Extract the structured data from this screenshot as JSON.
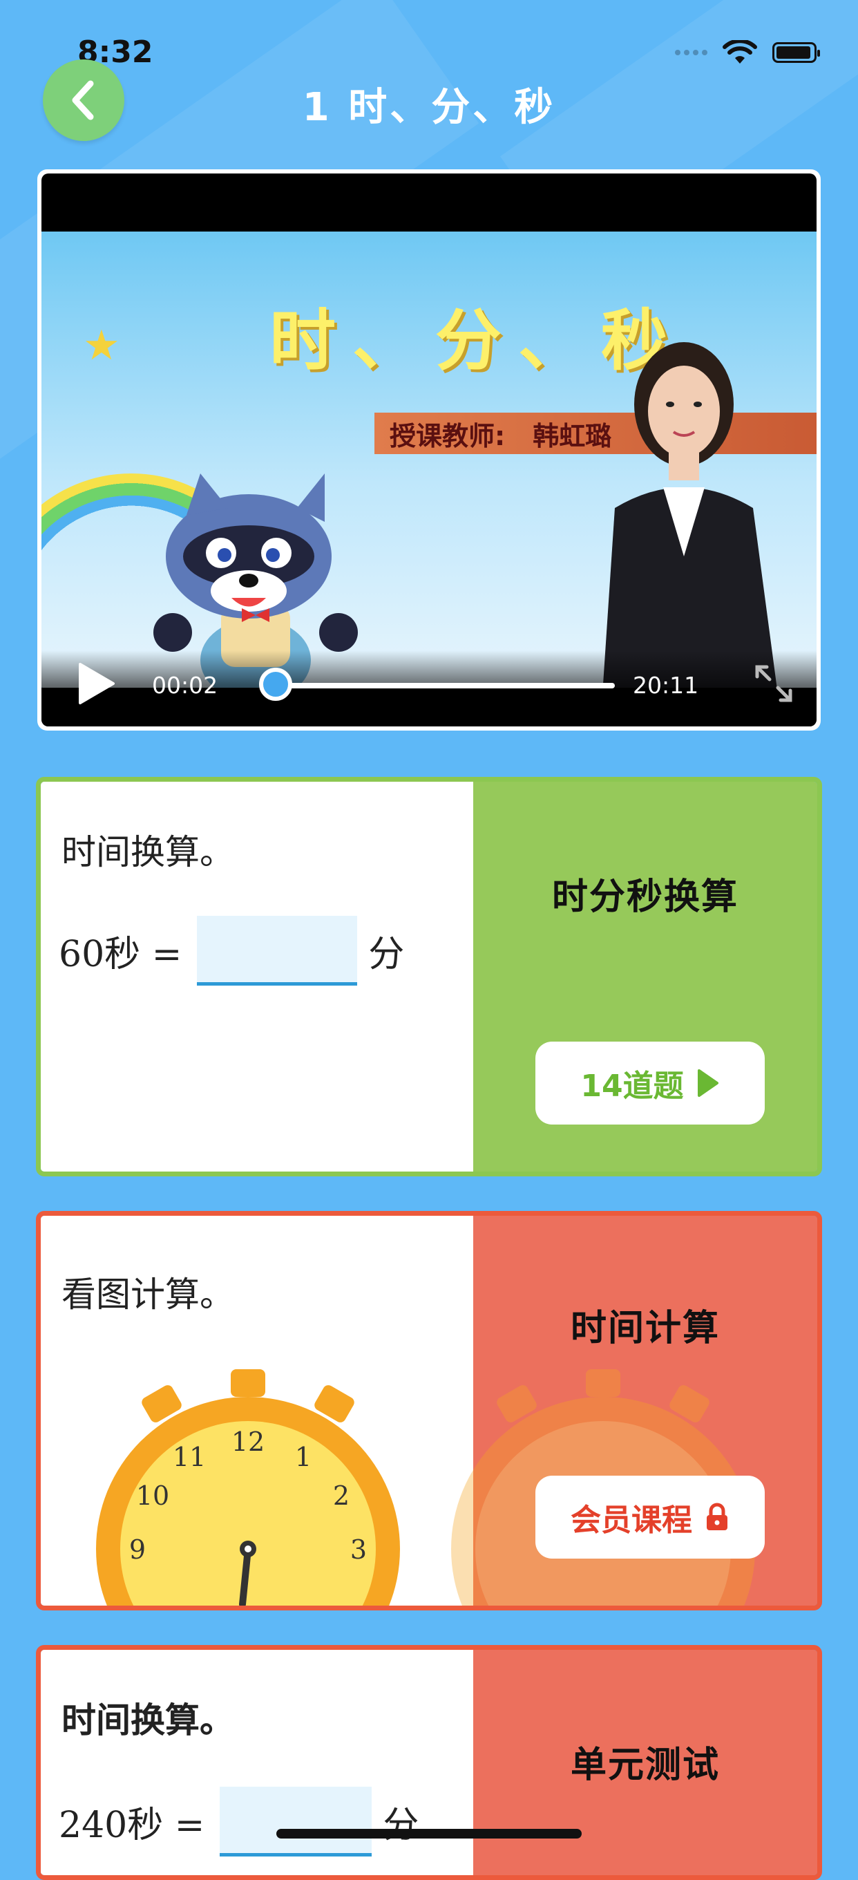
{
  "status": {
    "time": "8:32"
  },
  "header": {
    "title": "1 时、分、秒"
  },
  "video": {
    "slide_title": "时、分、秒",
    "teacher_label": "授课教师:",
    "teacher_name": "韩虹璐",
    "current_time": "00:02",
    "total_time": "20:11",
    "progress": 0.002
  },
  "cards": [
    {
      "question_title": "时间换算。",
      "question_lhs": "60秒 =",
      "question_unit": "分",
      "section_title": "时分秒换算",
      "action_label": "14道题",
      "action_icon": "play-triangle-icon",
      "accent": "#96c95a"
    },
    {
      "question_title": "看图计算。",
      "section_title": "时间计算",
      "action_label": "会员课程",
      "action_icon": "lock-icon",
      "accent": "#ec5a3c"
    },
    {
      "question_title": "时间换算。",
      "question_lhs": "240秒 =",
      "question_unit": "分",
      "section_title": "单元测试",
      "accent": "#ec5a3c"
    }
  ]
}
